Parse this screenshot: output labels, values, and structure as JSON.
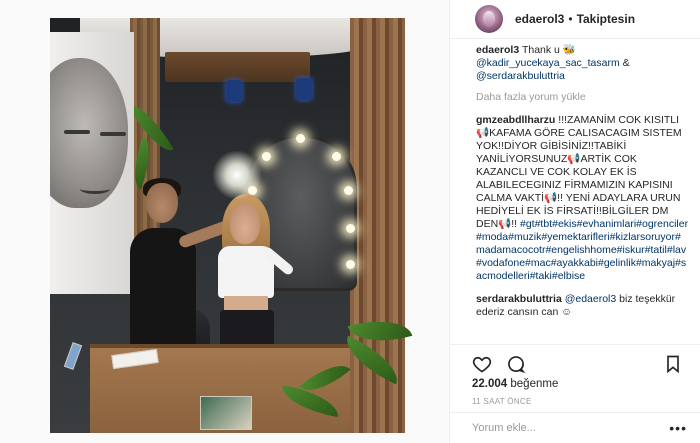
{
  "post": {
    "username": "edaerol3",
    "separator": "•",
    "follow_status": "Takiptesin",
    "likes_count": "22.004",
    "likes_label": "beğenme",
    "time_ago": "11 SAAT ÖNCE"
  },
  "caption": {
    "username": "edaerol3",
    "text": "Thank u",
    "emoji": "🐝",
    "mention1": "@kadir_yucekaya_sac_tasarm",
    "amp": "&",
    "mention2": "@serdarakbuluttria"
  },
  "load_more": "Daha fazla yorum yükle",
  "comment1": {
    "username": "gmzeabdllharzu",
    "text": "!!!ZAMANİM COK KISITLI 📢KAFAMA GÖRE CALISACAGIM SISTEM YOK!!DİYOR GİBİSİNİZ!!TABİKİ YANİLİYORSUNUZ📢ARTİK COK KAZANCLI VE COK KOLAY EK İS ALABILECEGINIZ FİRMAMIZIN KAPISINI CALMA VAKTİ📢!! YENİ ADAYLARA URUN HEDİYELİ EK İS FİRSATİ!!BİLGİLER DM DEN📢!!",
    "hashtags": "#gt#tbt#ekis#evhanimlari#ogrenciler#moda#muzik#yemektarifleri#kizlarsoruyor#madamacocotr#engelishhome#iskur#tatil#lav#vodafone#mac#ayakkabi#gelinlik#makyaj#sacmodelleri#taki#elbise"
  },
  "comment2": {
    "username": "serdarakbuluttria",
    "mention": "@edaerol3",
    "text": "biz teşekkür ederiz cansın can ☺"
  },
  "add_comment": {
    "placeholder": "Yorum ekle...",
    "more": "•••"
  }
}
